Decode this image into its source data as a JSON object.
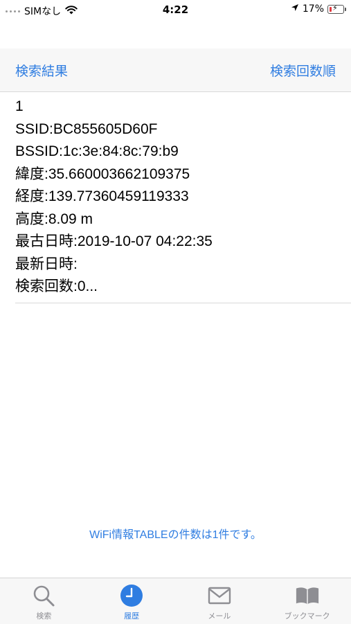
{
  "status_bar": {
    "carrier": "SIMなし",
    "time": "4:22",
    "battery_percent_text": "17%",
    "battery_level": 0.17,
    "icons": [
      "signal-dots-icon",
      "wifi-icon",
      "location-arrow-icon",
      "battery-charging-icon"
    ]
  },
  "nav": {
    "left_label": "検索結果",
    "right_label": "検索回数順"
  },
  "result": {
    "index": "1",
    "ssid": "SSID:BC855605D60F",
    "bssid": "BSSID:1c:3e:84:8c:79:b9",
    "latitude": "緯度:35.660003662109375",
    "longitude": "経度:139.77360459119333",
    "altitude": "高度:8.09 m",
    "oldest": "最古日時:2019-10-07 04:22:35",
    "newest": "最新日時:",
    "search_count": "検索回数:0..."
  },
  "footer": {
    "count_text": "WiFi情報TABLEの件数は1件です。"
  },
  "tab_bar": {
    "tabs": [
      {
        "label": "検索",
        "icon": "search-icon"
      },
      {
        "label": "履歴",
        "icon": "clock-icon",
        "active": true
      },
      {
        "label": "メール",
        "icon": "mail-icon"
      },
      {
        "label": "ブックマーク",
        "icon": "book-icon"
      }
    ]
  },
  "colors": {
    "accent": "#2f7de1",
    "tab_inactive": "#8e8e93",
    "battery_low": "#e0383e"
  }
}
